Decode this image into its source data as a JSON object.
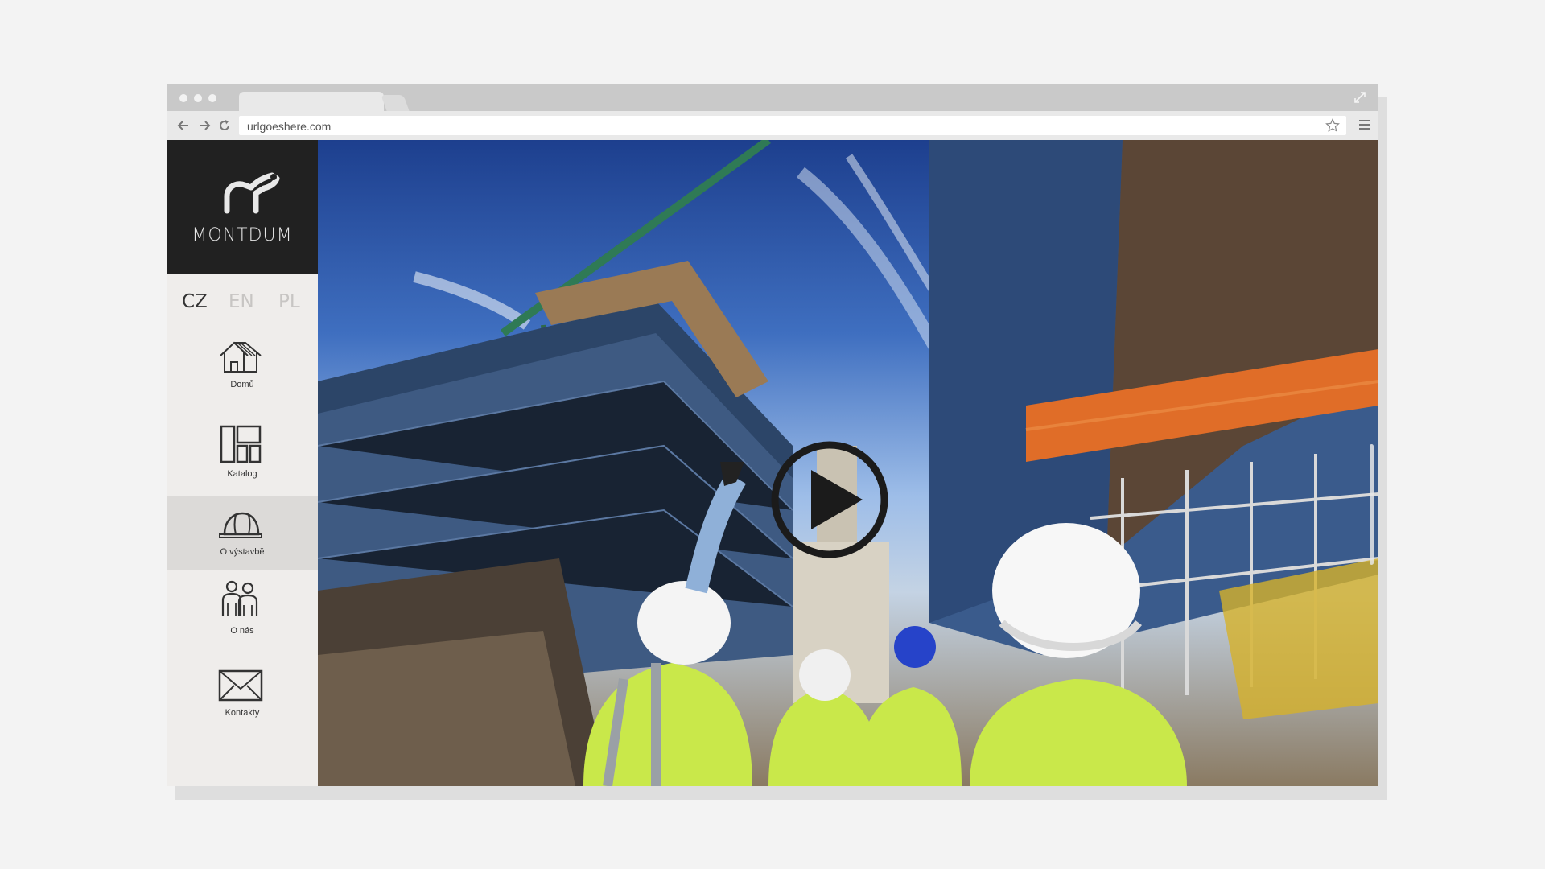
{
  "browser": {
    "url": "urlgoeshere.com",
    "icons": [
      "back-arrow-icon",
      "forward-arrow-icon",
      "reload-icon",
      "star-icon",
      "menu-icon",
      "expand-icon"
    ]
  },
  "sidebar": {
    "brand": "MONTDUM",
    "languages": [
      {
        "code": "CZ",
        "active": true
      },
      {
        "code": "EN",
        "active": false
      },
      {
        "code": "PL",
        "active": false
      }
    ],
    "items": [
      {
        "label": "Domů",
        "icon": "home-icon",
        "active": false
      },
      {
        "label": "Katalog",
        "icon": "catalog-grid-icon",
        "active": false
      },
      {
        "label": "O výstavbě",
        "icon": "hardhat-icon",
        "active": true
      },
      {
        "label": "O nás",
        "icon": "people-icon",
        "active": false
      },
      {
        "label": "Kontakty",
        "icon": "envelope-icon",
        "active": false
      }
    ]
  },
  "hero": {
    "media": "construction-site-video",
    "play_icon": "play-icon"
  },
  "colors": {
    "page_bg": "#f3f3f3",
    "sidebar_bg": "#efedeb",
    "logo_bg": "#212121",
    "active_item_bg": "#dcdad8",
    "lang_active": "#333333",
    "lang_inactive": "#c7c5c3"
  }
}
